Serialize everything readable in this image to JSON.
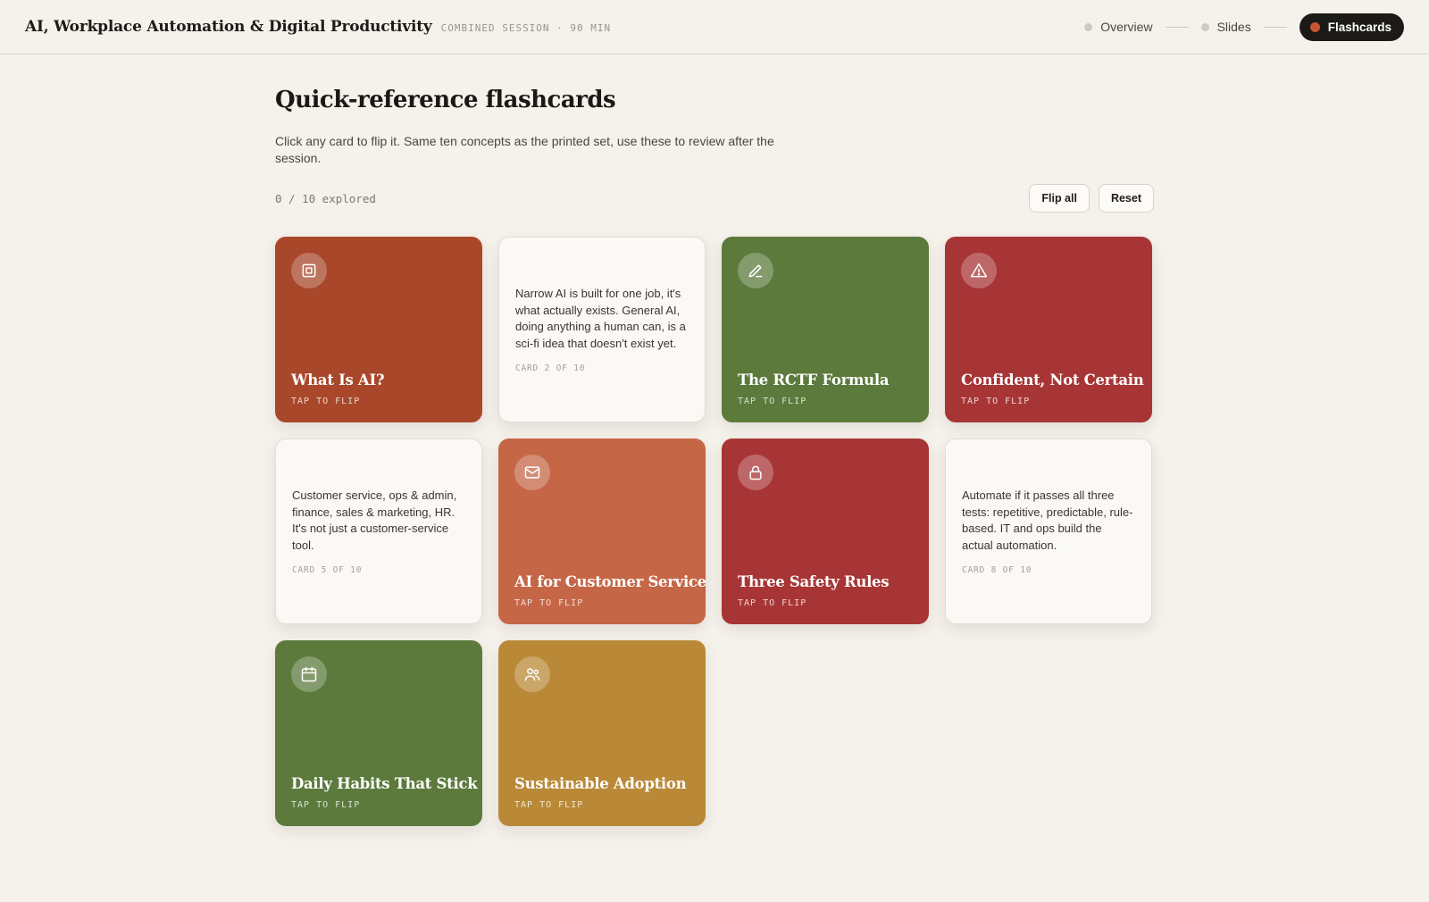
{
  "header": {
    "title": "AI, Workplace Automation & Digital Productivity",
    "session_tag": "COMBINED SESSION · 90 MIN",
    "nav": [
      {
        "label": "Overview"
      },
      {
        "label": "Slides"
      },
      {
        "label": "Flashcards",
        "active": true
      }
    ]
  },
  "main": {
    "title": "Quick-reference flashcards",
    "description": "Click any card to flip it. Same ten concepts as the printed set, use these to review after the session.",
    "progress": "0 / 10 explored",
    "buttons": {
      "flip_all": "Flip all",
      "reset": "Reset"
    }
  },
  "cards": [
    {
      "state": "front",
      "icon": "chip-icon",
      "color": "#a9472a",
      "title": "What Is AI?",
      "hint": "TAP TO FLIP"
    },
    {
      "state": "back",
      "text": "Narrow AI is built for one job, it's what actually exists. General AI, doing anything a human can, is a sci-fi idea that doesn't exist yet.",
      "meta": "CARD 2 OF 10"
    },
    {
      "state": "front",
      "icon": "pencil-icon",
      "color": "#5b7a3c",
      "title": "The RCTF Formula",
      "hint": "TAP TO FLIP"
    },
    {
      "state": "front",
      "icon": "warning-icon",
      "color": "#a83536",
      "title": "Confident, Not Certain",
      "hint": "TAP TO FLIP"
    },
    {
      "state": "back",
      "text": "Customer service, ops & admin, finance, sales & marketing, HR. It's not just a customer-service tool.",
      "meta": "CARD 5 OF 10"
    },
    {
      "state": "front",
      "icon": "mail-icon",
      "color": "#c56747",
      "title": "AI for Customer Service",
      "hint": "TAP TO FLIP"
    },
    {
      "state": "front",
      "icon": "lock-icon",
      "color": "#a83536",
      "title": "Three Safety Rules",
      "hint": "TAP TO FLIP"
    },
    {
      "state": "back",
      "text": "Automate if it passes all three tests: repetitive, predictable, rule-based. IT and ops build the actual automation.",
      "meta": "CARD 8 OF 10"
    },
    {
      "state": "front",
      "icon": "calendar-icon",
      "color": "#5b7a3c",
      "title": "Daily Habits That Stick",
      "hint": "TAP TO FLIP"
    },
    {
      "state": "front",
      "icon": "users-icon",
      "color": "#b98937",
      "title": "Sustainable Adoption",
      "hint": "TAP TO FLIP"
    }
  ]
}
